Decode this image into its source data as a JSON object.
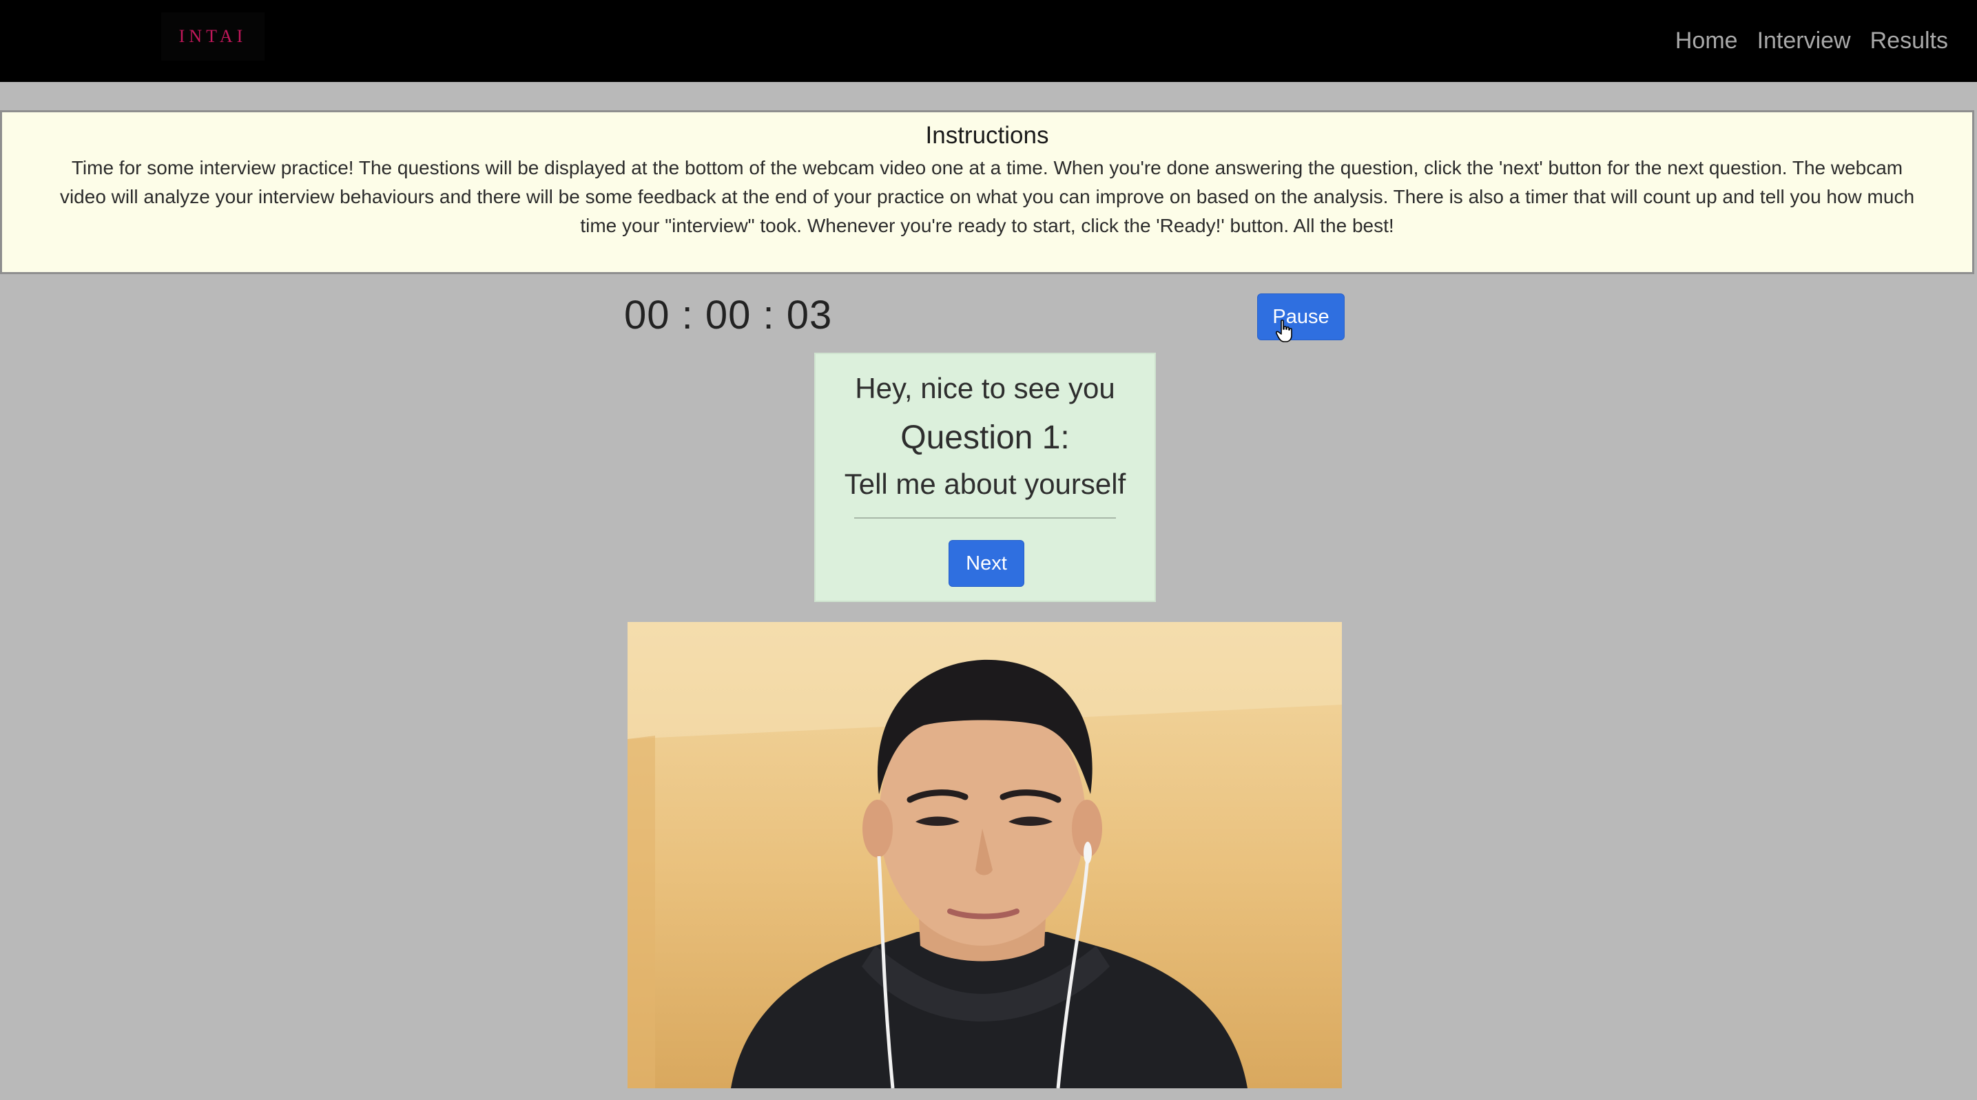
{
  "navbar": {
    "brand": "INTAI",
    "links": [
      "Home",
      "Interview",
      "Results"
    ]
  },
  "instructions": {
    "title": "Instructions",
    "body": "Time for some interview practice! The questions will be displayed at the bottom of the webcam video one at a time. When you're done answering the question, click the 'next' button for the next question. The webcam video will analyze your interview behaviours and there will be some feedback at the end of your practice on what you can improve on based on the analysis. There is also a timer that will count up and tell you how much time your \"interview\" took. Whenever you're ready to start, click the 'Ready!' button. All the best!"
  },
  "timer": {
    "display": "00 : 00 : 03"
  },
  "controls": {
    "pause_label": "Pause"
  },
  "question": {
    "greeting": "Hey, nice to see you",
    "number_label": "Question 1:",
    "text": "Tell me about yourself",
    "next_label": "Next"
  },
  "colors": {
    "navbar": "#000000",
    "brand": "#c2185b",
    "page_bg": "#b9b9b9",
    "instructions_bg": "#fdfde8",
    "card_bg": "#dcf0dc",
    "button": "#2f6fe0"
  },
  "icons": {
    "cursor": "hand-pointer-icon"
  }
}
